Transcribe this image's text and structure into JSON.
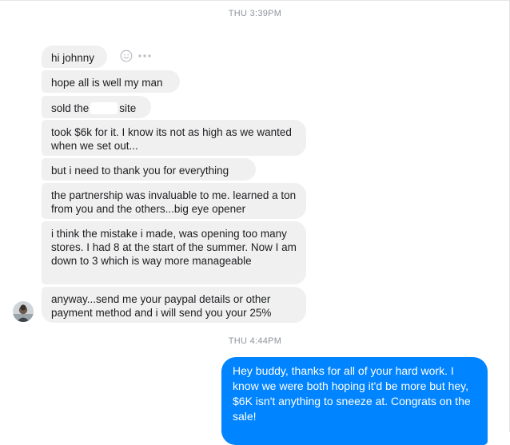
{
  "conversation": {
    "timestamp_1": "THU 3:39PM",
    "timestamp_2": "THU 4:44PM",
    "received": [
      "hi johnny",
      "hope all is well my man",
      "took $6k for it. I know its not as high as we wanted when we set out...",
      "but i need to thank you for everything",
      "the partnership was invaluable to me. learned a ton from you and the others...big eye opener",
      "i think the mistake i made, was opening too many stores. I had 8 at the start of the summer. Now I am down to 3 which is way more manageable",
      "anyway...send me your paypal details or other payment method and i will send you your 25%"
    ],
    "redacted_message": {
      "before": "sold the",
      "after": "site"
    },
    "sent": [
      "Hey buddy, thanks for all of your hard work. I know we were both hoping it'd be more but hey, $6K isn't anything to sneeze at. Congrats on the sale!"
    ]
  },
  "icons": {
    "react": "smiley-icon",
    "more": "more-dots-icon",
    "sender_avatar": "avatar"
  },
  "colors": {
    "received_bubble": "#f1f0f0",
    "sent_bubble": "#0084ff",
    "timestamp": "#90949c"
  }
}
